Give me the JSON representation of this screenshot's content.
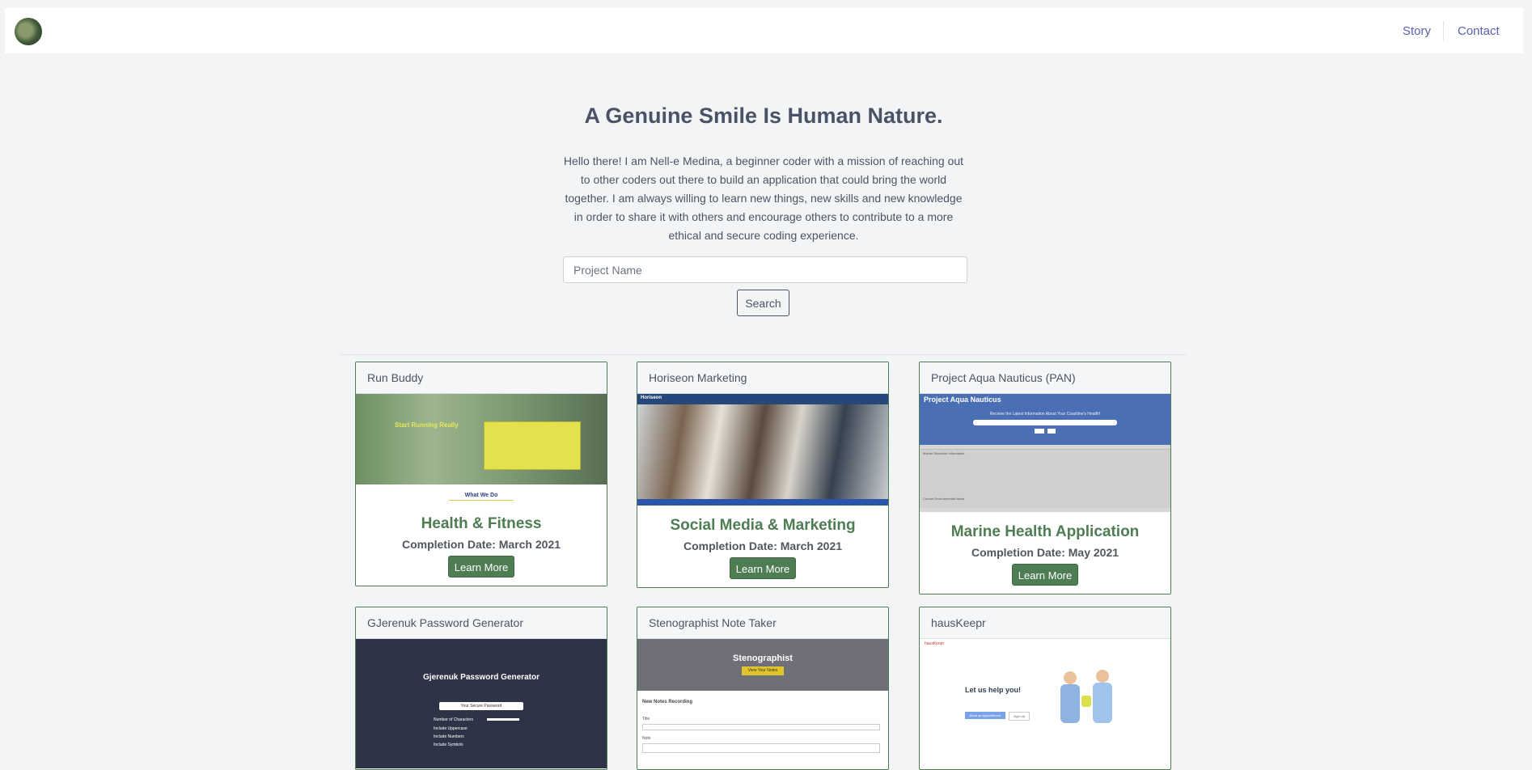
{
  "nav": {
    "logo": "logo",
    "links": [
      "Story",
      "Contact"
    ]
  },
  "hero": {
    "title": "A Genuine Smile Is Human Nature.",
    "text": "Hello there! I am Nell-e Medina, a beginner coder with a mission of reaching out to other coders out there to build an application that could bring the world together. I am always willing to learn new things, new skills and new knowledge in order to share it with others and encourage others to contribute to a more ethical and secure coding experience."
  },
  "search": {
    "placeholder": "Project Name",
    "value": "",
    "button": "Search"
  },
  "projects": [
    {
      "title": "Run Buddy",
      "category": "Health & Fitness",
      "completion": "Completion Date: March 2021",
      "button": "Learn More"
    },
    {
      "title": "Horiseon Marketing",
      "category": "Social Media & Marketing",
      "completion": "Completion Date: March 2021",
      "button": "Learn More"
    },
    {
      "title": "Project Aqua Nauticus (PAN)",
      "category": "Marine Health Application",
      "completion": "Completion Date: May 2021",
      "button": "Learn More"
    },
    {
      "title": "GJerenuk Password Generator"
    },
    {
      "title": "Stenographist Note Taker"
    },
    {
      "title": "hausKeepr"
    }
  ],
  "screenshots": {
    "runbuddy": {
      "heading": "Start Running Really",
      "section": "What We Do"
    },
    "horiseon": {
      "brand": "Horiseon"
    },
    "pan": {
      "heading": "Project Aqua Nauticus",
      "tagline": "Receive the Latest Information About Your Coastline's Health!",
      "section1": "Marine Shoreline Information",
      "section2": "Current Environmental News"
    },
    "password": {
      "heading": "Gjerenuk Password Generator",
      "box": "Your Secure Password",
      "options": [
        "Number of Characters",
        "Include Uppercase",
        "Include Numbers",
        "Include Symbols"
      ]
    },
    "steno": {
      "heading": "Stenographist",
      "button": "View Your Notes",
      "section": "New Notes Recording",
      "field1": "Title",
      "field2": "Note"
    },
    "haus": {
      "brand": "hausKeepr",
      "heading": "Let us help you!",
      "button": "Book an Appointment",
      "button2": "Sign Up"
    }
  },
  "colors": {
    "accent": "#4e7d53",
    "link": "#5a5fb0",
    "background": "#f3f4f6"
  }
}
